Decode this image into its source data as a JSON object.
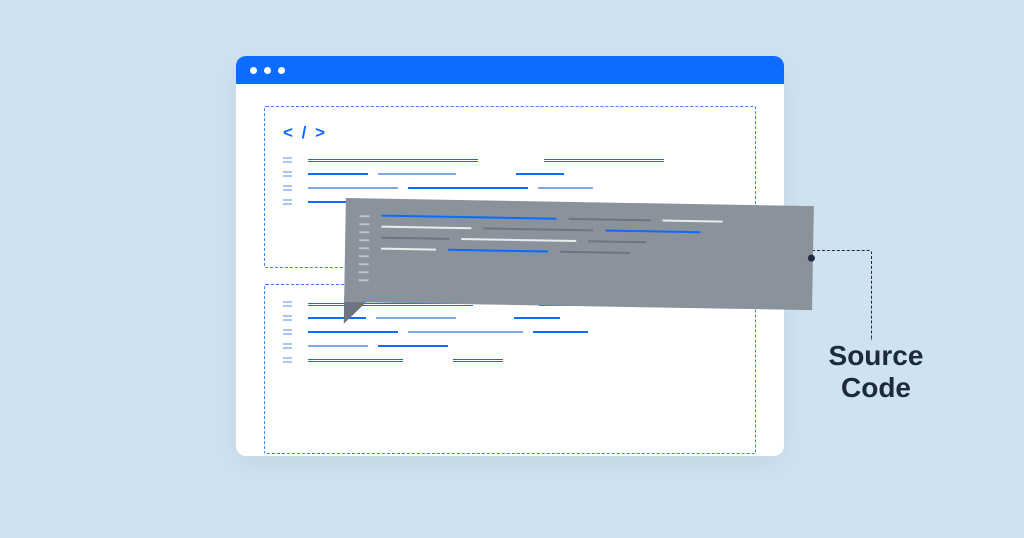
{
  "label": {
    "line1": "Source",
    "line2": "Code"
  },
  "icon_glyph": "< / >",
  "colors": {
    "background": "#cfe2ef",
    "window_chrome": "#0b6cff",
    "snippet_bg": "#8a929c",
    "label_text": "#1d2a3a"
  }
}
